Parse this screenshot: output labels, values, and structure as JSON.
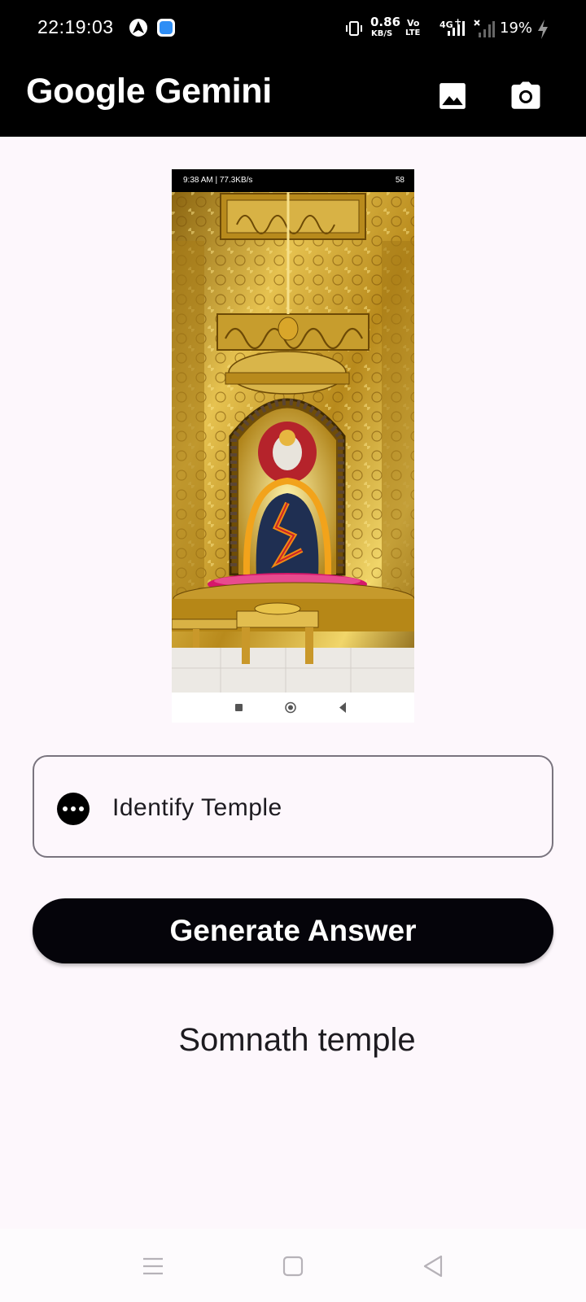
{
  "status_bar": {
    "time": "22:19:03",
    "net_speed_value": "0.86",
    "net_speed_unit": "KB/S",
    "volte_top": "Vo",
    "volte_bottom": "LTE",
    "network_type": "4G",
    "network_superscript": "+",
    "battery": "19%"
  },
  "app_bar": {
    "title": "Google Gemini",
    "gallery_icon": "image-icon",
    "camera_icon": "camera-icon"
  },
  "attached_image": {
    "status_left": "9:38 AM | 77.3KB/s",
    "status_right": "58"
  },
  "prompt": {
    "text": "Identify Temple",
    "icon": "more-horizontal-icon"
  },
  "generate_button": {
    "label": "Generate Answer"
  },
  "answer": {
    "text": "Somnath temple"
  },
  "colors": {
    "app_bar_bg": "#000000",
    "page_bg": "#fdf7fc",
    "button_bg": "#05040a",
    "outline": "#79747e"
  }
}
